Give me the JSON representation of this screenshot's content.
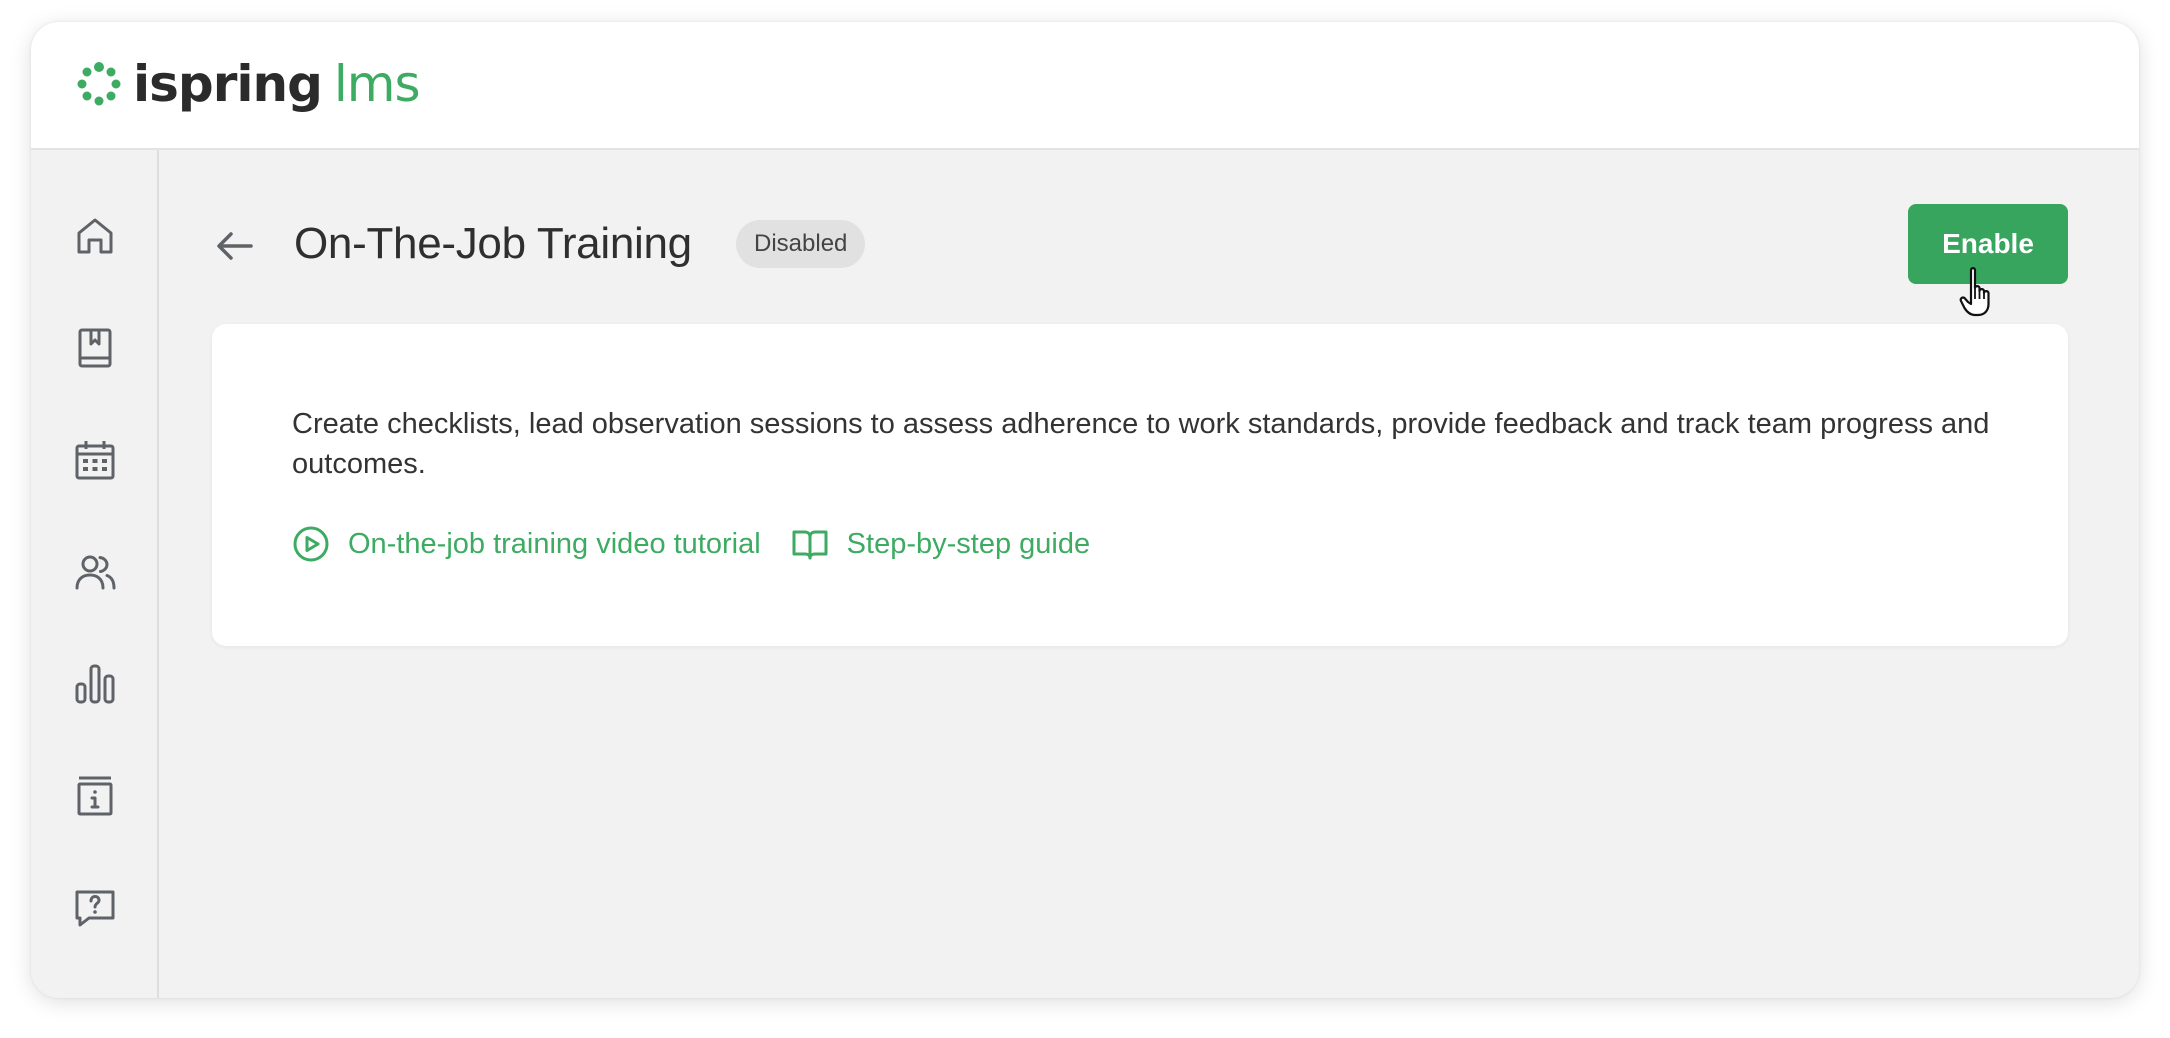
{
  "app": {
    "logo_word": "ispring",
    "logo_suffix": "lms",
    "brand_color": "#3dab62"
  },
  "sidebar": {
    "items": [
      {
        "icon": "home-icon"
      },
      {
        "icon": "book-icon"
      },
      {
        "icon": "calendar-icon"
      },
      {
        "icon": "users-icon"
      },
      {
        "icon": "reports-icon"
      },
      {
        "icon": "info-icon"
      },
      {
        "icon": "help-icon"
      }
    ]
  },
  "header": {
    "title": "On-The-Job Training",
    "status": "Disabled",
    "enable_label": "Enable",
    "enable_color": "#37a55e"
  },
  "card": {
    "description": "Create checklists, lead observation sessions to assess adherence to work standards, provide feedback and track team progress and outcomes.",
    "links": [
      {
        "label": "On-the-job training video tutorial",
        "icon": "play-circle-icon"
      },
      {
        "label": "Step-by-step guide",
        "icon": "open-book-icon"
      }
    ]
  }
}
